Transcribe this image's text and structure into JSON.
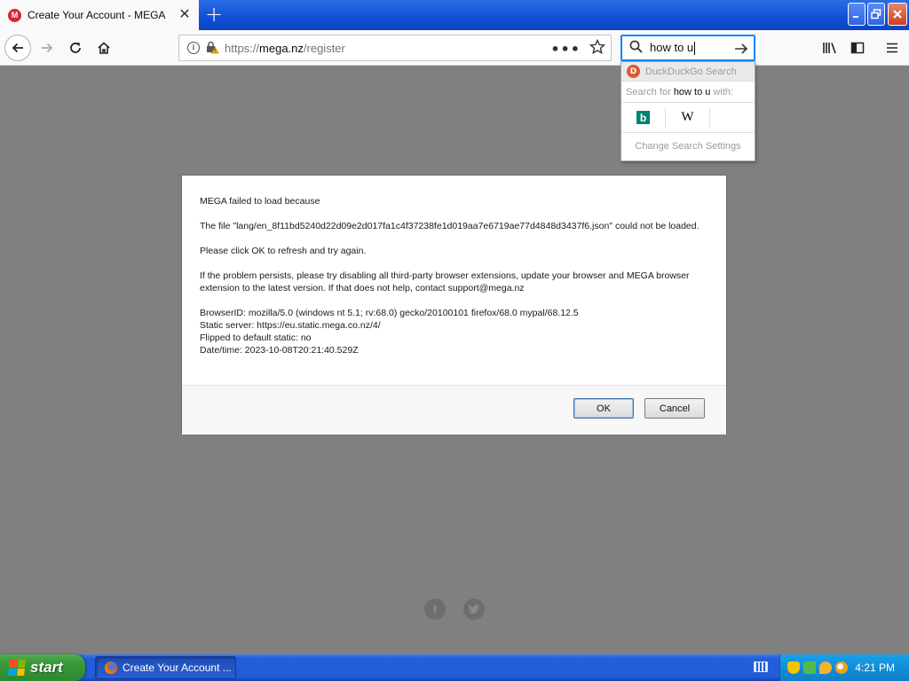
{
  "browser": {
    "tab_title": "Create Your Account - MEGA",
    "tab_favicon_letter": "M",
    "url_scheme": "https://",
    "url_host": "mega.nz",
    "url_path": "/register",
    "search_text": "how to u",
    "icons": [
      "back-icon",
      "forward-icon",
      "reload-icon",
      "home-icon",
      "info-icon",
      "lock-warning-icon",
      "page-actions-icon",
      "bookmark-star-icon",
      "search-icon",
      "go-arrow-icon",
      "library-icon",
      "sidebar-icon",
      "hamburger-menu-icon"
    ]
  },
  "search_popup": {
    "engine_label": "DuckDuckGo Search",
    "search_for_prefix": "Search for ",
    "search_for_query": "how to u",
    "search_for_suffix": " with:",
    "engine_icons": [
      "bing-icon",
      "wikipedia-icon"
    ],
    "bing_letter": "b",
    "wiki_letter": "W",
    "settings_label": "Change Search Settings"
  },
  "dialog": {
    "line1": "MEGA failed to load because",
    "line2": "The file \"lang/en_8f11bd5240d22d09e2d017fa1c4f37238fe1d019aa7e6719ae77d4848d3437f6.json\" could not be loaded.",
    "line3": "Please click OK to refresh and try again.",
    "line4": "If the problem persists, please try disabling all third-party browser extensions, update your browser and MEGA browser extension to the latest version. If that does not help, contact support@mega.nz",
    "browser_id": "BrowserID: mozilla/5.0 (windows nt 5.1; rv:68.0) gecko/20100101 firefox/68.0 mypal/68.12.5",
    "static_server": "Static server: https://eu.static.mega.co.nz/4/",
    "flipped": "Flipped to default static: no",
    "datetime": "Date/time: 2023-10-08T20:21:40.529Z",
    "ok_label": "OK",
    "cancel_label": "Cancel"
  },
  "footer": {
    "facebook_glyph": "f",
    "twitter_glyph": "t"
  },
  "taskbar": {
    "start_label": "start",
    "task_label": "Create Your Account ...",
    "clock": "4:21 PM"
  }
}
